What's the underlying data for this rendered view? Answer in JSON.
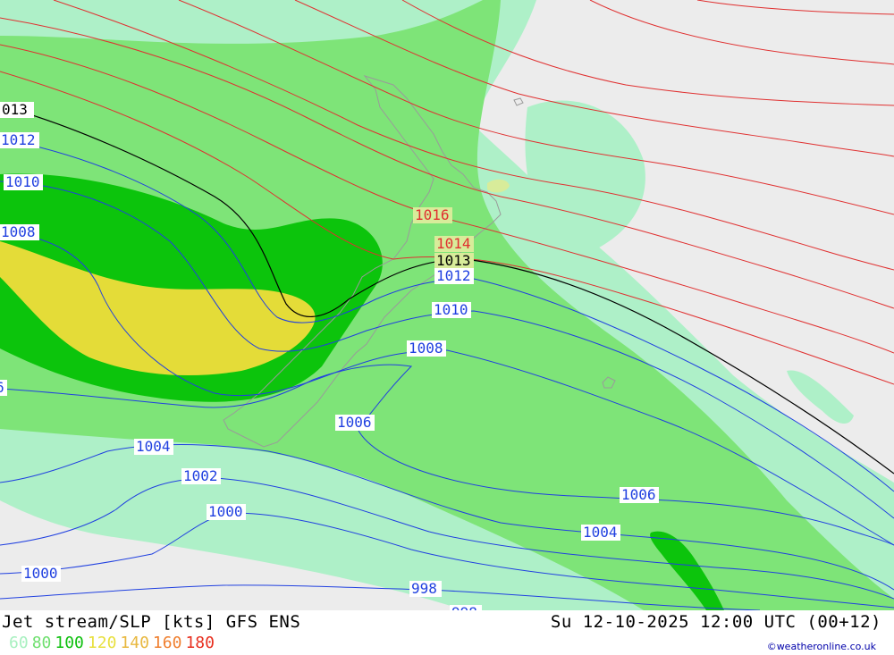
{
  "footer": {
    "title": "Jet stream/SLP [kts] GFS ENS",
    "datetime": "Su 12-10-2025 12:00 UTC (00+12)",
    "credit": "©weatheronline.co.uk",
    "legend": [
      {
        "label": "60",
        "color": "#a8f0c0"
      },
      {
        "label": "80",
        "color": "#70e070"
      },
      {
        "label": "100",
        "color": "#10c010"
      },
      {
        "label": "120",
        "color": "#e8e040"
      },
      {
        "label": "140",
        "color": "#e8b840"
      },
      {
        "label": "160",
        "color": "#f08030"
      },
      {
        "label": "180",
        "color": "#e83020"
      }
    ]
  },
  "isobars": {
    "red": [
      "1016",
      "1014"
    ],
    "black": [
      "013",
      "1013"
    ],
    "blue": [
      "1012",
      "1010",
      "1008",
      "6",
      "1012",
      "1010",
      "1008",
      "1006",
      "1004",
      "1002",
      "1000",
      "1000",
      "998",
      "1006",
      "1004",
      "998"
    ]
  },
  "colors": {
    "background": "#ececec",
    "jet_60": "#aef0c8",
    "jet_80": "#7ee478",
    "jet_100": "#0cc40c",
    "jet_120": "#e4dc38",
    "isobar_high": "#e03030",
    "isobar_ref": "#000000",
    "isobar_low": "#2040e0"
  }
}
